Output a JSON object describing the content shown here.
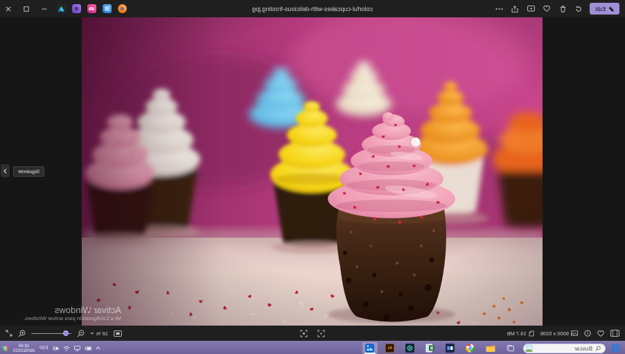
{
  "note": "Screen is a horizontally mirrored Windows screenshot of the Photos app",
  "titlebar": {
    "filename": "colorful-cupcakes-with-delicious-frosting.jpg",
    "edit_label": "Edit"
  },
  "statusbar": {
    "dimensions": "6000 x 5336",
    "file_size": "19.7 MB",
    "zoom_level": "18 %"
  },
  "viewer": {
    "next_tooltip": "Siguiente"
  },
  "watermark": {
    "line1": "Activar Windows",
    "line2": "Ve a Configuración para activar Windows."
  },
  "taskbar": {
    "search_placeholder": "Buscar",
    "apps": {
      "illustrator_label": "Ai"
    },
    "tray": {
      "language": "ESP",
      "time": "18:48",
      "date": "26/05/2023"
    }
  },
  "photo": {
    "subject": "Chocolate cupcakes with colorful frosting swirls and heart sprinkles on a magenta background",
    "frosting_colors": [
      "#f09fb6",
      "#f8d916",
      "#5bc7f0",
      "#f79a18",
      "#f5f0ea"
    ],
    "wall_color": "#a83073",
    "surface_color": "#ecd9d2"
  },
  "accent": {
    "purple": "#9f8fd6",
    "taskbar_purple": "#7a6fa8"
  }
}
